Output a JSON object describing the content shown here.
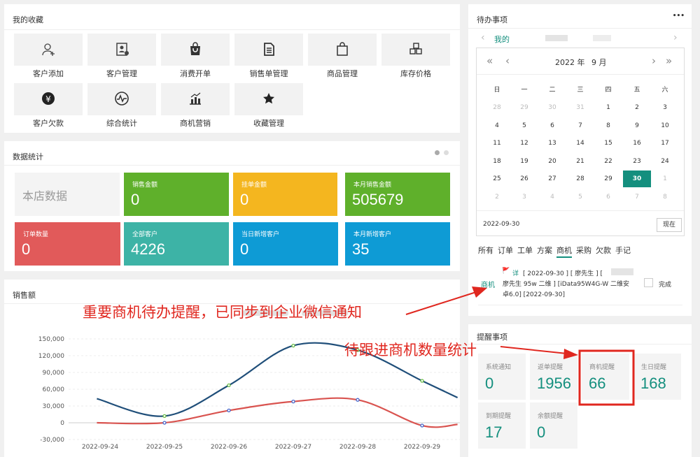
{
  "favorites": {
    "title": "我的收藏",
    "items": [
      {
        "label": "客户添加",
        "icon": "user-plus-icon"
      },
      {
        "label": "客户管理",
        "icon": "contact-card-icon"
      },
      {
        "label": "消费开单",
        "icon": "shopping-bag-icon"
      },
      {
        "label": "销售单管理",
        "icon": "document-icon"
      },
      {
        "label": "商品管理",
        "icon": "bag-icon"
      },
      {
        "label": "库存价格",
        "icon": "boxes-icon"
      },
      {
        "label": "客户欠款",
        "icon": "yen-icon"
      },
      {
        "label": "综合统计",
        "icon": "pulse-icon"
      },
      {
        "label": "商机营销",
        "icon": "bar-chart-icon"
      },
      {
        "label": "收藏管理",
        "icon": "star-icon"
      }
    ]
  },
  "stats": {
    "title": "数据统计",
    "store_label": "本店数据",
    "tiles": [
      {
        "label": "销售金额",
        "value": "0",
        "color": "#5fb02b"
      },
      {
        "label": "挂单金额",
        "value": "0",
        "color": "#f4b61f"
      },
      {
        "label": "本月销售金额",
        "value": "505679",
        "color": "#5fb02b"
      },
      {
        "label": "订单数量",
        "value": "0",
        "color": "#e15a5a"
      },
      {
        "label": "全部客户",
        "value": "4226",
        "color": "#3db3a6"
      },
      {
        "label": "当日新增客户",
        "value": "0",
        "color": "#0e9bd5"
      },
      {
        "label": "本月新增客户",
        "value": "35",
        "color": "#0e9bd5"
      }
    ]
  },
  "sales": {
    "title": "销售额"
  },
  "chart_data": {
    "type": "line",
    "x": [
      "2022-09-24",
      "2022-09-25",
      "2022-09-26",
      "2022-09-27",
      "2022-09-28",
      "2022-09-29"
    ],
    "ylim": [
      -30000,
      150000
    ],
    "yticks": [
      "150,000",
      "120,000",
      "90,000",
      "60,000",
      "30,000",
      "0",
      "-30,000"
    ],
    "series": [
      {
        "color": "#1f4e79",
        "points": [
          [
            -0.05,
            43000
          ],
          [
            1,
            12000
          ],
          [
            2,
            67000
          ],
          [
            3,
            138000
          ],
          [
            4,
            130000
          ],
          [
            5,
            75000
          ],
          [
            5.55,
            45000
          ]
        ]
      },
      {
        "color": "#d9534f",
        "points": [
          [
            -0.05,
            0
          ],
          [
            1,
            0
          ],
          [
            2,
            22000
          ],
          [
            3,
            38000
          ],
          [
            4,
            41000
          ],
          [
            5,
            -5000
          ],
          [
            5.55,
            -3000
          ]
        ]
      }
    ]
  },
  "todo": {
    "title": "待办事项",
    "more": "•••",
    "my": "我的",
    "calendar": {
      "year": "2022 年",
      "month": "9 月",
      "weekdays": [
        "日",
        "一",
        "二",
        "三",
        "四",
        "五",
        "六"
      ],
      "days": [
        "28",
        "29",
        "30",
        "31",
        "1",
        "2",
        "3",
        "4",
        "5",
        "6",
        "7",
        "8",
        "9",
        "10",
        "11",
        "12",
        "13",
        "14",
        "15",
        "16",
        "17",
        "18",
        "19",
        "20",
        "21",
        "22",
        "23",
        "24",
        "25",
        "26",
        "27",
        "28",
        "29",
        "30",
        "1",
        "2",
        "3",
        "4",
        "5",
        "6",
        "7",
        "8"
      ],
      "selected": "2022-09-30",
      "now_button": "现在"
    },
    "tabs": [
      "所有",
      "订单",
      "工单",
      "方案",
      "商机",
      "采购",
      "欠款",
      "手记"
    ],
    "item": {
      "type": "商机",
      "flag": "🚩",
      "detail": "详",
      "line1": "[ 2022-09-30 ] [ 廖先生 ] [",
      "line2": "廖先生 95w 二维 ] [iData95W4G-W 二维安",
      "line3": "卓6.0] [2022-09-30]",
      "done": "完成"
    }
  },
  "reminders": {
    "title": "提醒事项",
    "items": [
      {
        "label": "系统通知",
        "value": "0"
      },
      {
        "label": "返单提醒",
        "value": "1956"
      },
      {
        "label": "商机提醒",
        "value": "66"
      },
      {
        "label": "生日提醒",
        "value": "168"
      },
      {
        "label": "到期提醒",
        "value": "17"
      },
      {
        "label": "余额提醒",
        "value": "0"
      }
    ]
  },
  "annotations": {
    "a1": "重要商机待办提醒，已同步到企业微信通知",
    "a2": "待跟进商机数量统计"
  }
}
